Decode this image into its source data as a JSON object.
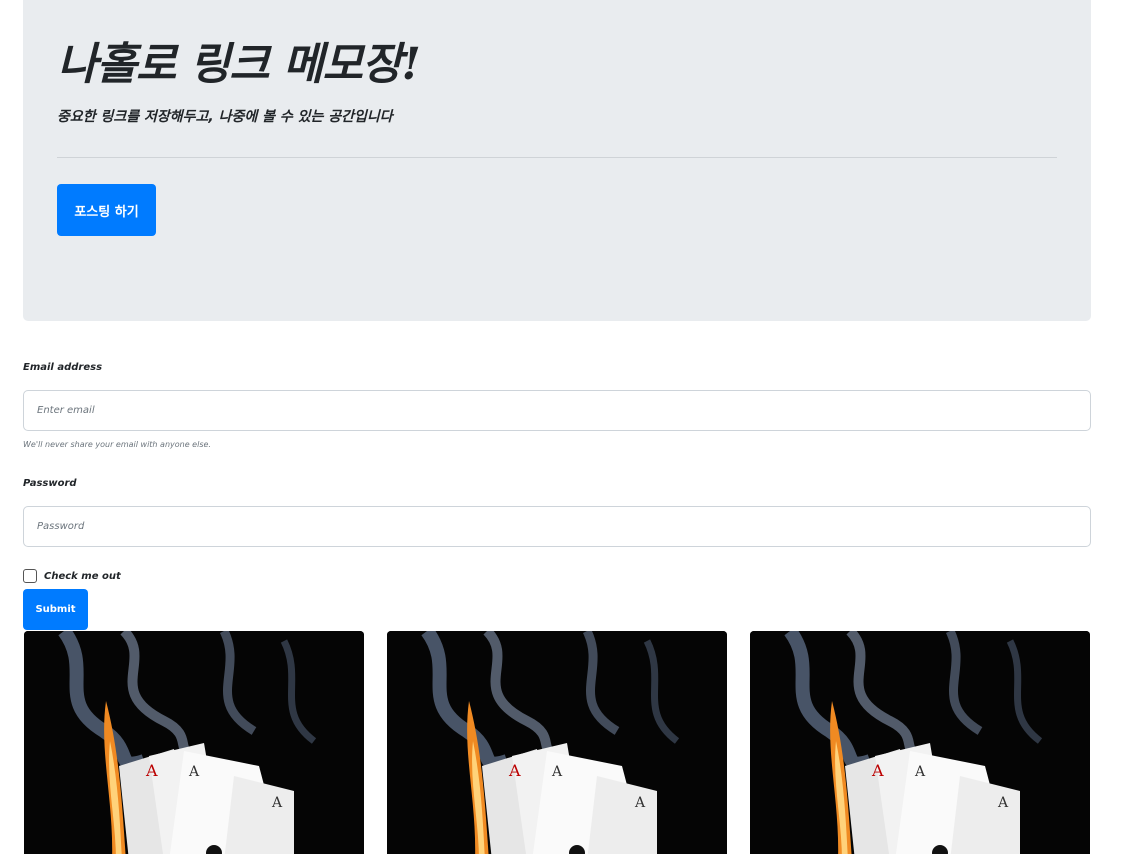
{
  "jumbotron": {
    "title": "나홀로 링크 메모장!",
    "lead": "중요한 링크를 저장해두고, 나중에 볼 수 있는 공간입니다",
    "button_label": "포스팅 하기"
  },
  "form": {
    "email_label": "Email address",
    "email_placeholder": "Enter email",
    "email_help": "We'll never share your email with anyone else.",
    "password_label": "Password",
    "password_placeholder": "Password",
    "checkbox_label": "Check me out",
    "submit_label": "Submit"
  },
  "cards": [
    {
      "image": "burning-aces-playing-cards-smoke"
    },
    {
      "image": "burning-aces-playing-cards-smoke"
    },
    {
      "image": "burning-aces-playing-cards-smoke"
    }
  ],
  "colors": {
    "jumbotron_bg": "#e9ecef",
    "primary": "#007bff",
    "input_border": "#ced4da"
  }
}
